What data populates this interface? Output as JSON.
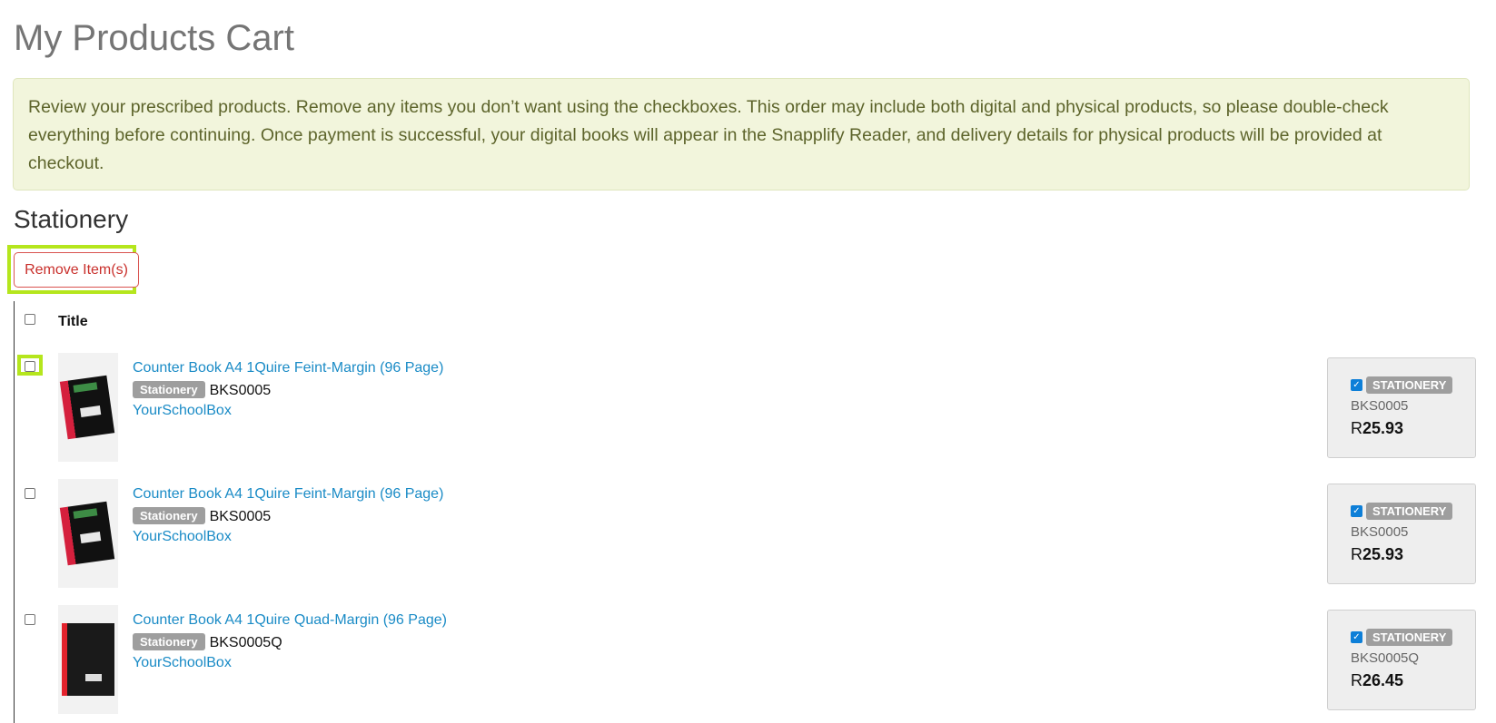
{
  "page_title": "My Products Cart",
  "notice": "Review your prescribed products. Remove any items you don’t want using the checkboxes. This order may include both digital and physical products, so please double-check everything before continuing. Once payment is successful, your digital books will appear in the Snapplify Reader, and delivery details for physical products will be provided at checkout.",
  "section": {
    "heading": "Stationery",
    "remove_button": "Remove Item(s)",
    "column_title": "Title"
  },
  "items": [
    {
      "title": "Counter Book A4 1Quire Feint-Margin (96 Page)",
      "category_badge": "Stationery",
      "code": "BKS0005",
      "supplier": "YourSchoolBox",
      "card_badge": "STATIONERY",
      "card_code": "BKS0005",
      "currency": "R",
      "price": "25.93",
      "checked": false
    },
    {
      "title": "Counter Book A4 1Quire Feint-Margin (96 Page)",
      "category_badge": "Stationery",
      "code": "BKS0005",
      "supplier": "YourSchoolBox",
      "card_badge": "STATIONERY",
      "card_code": "BKS0005",
      "currency": "R",
      "price": "25.93",
      "checked": false
    },
    {
      "title": "Counter Book A4 1Quire Quad-Margin (96 Page)",
      "category_badge": "Stationery",
      "code": "BKS0005Q",
      "supplier": "YourSchoolBox",
      "card_badge": "STATIONERY",
      "card_code": "BKS0005Q",
      "currency": "R",
      "price": "26.45",
      "checked": false
    }
  ],
  "colors": {
    "highlight": "#b5e61d",
    "link": "#1a8bc6",
    "notice_bg": "#f2f5dc",
    "danger": "#d9534f",
    "checkbox_checked": "#0d7fd8"
  }
}
